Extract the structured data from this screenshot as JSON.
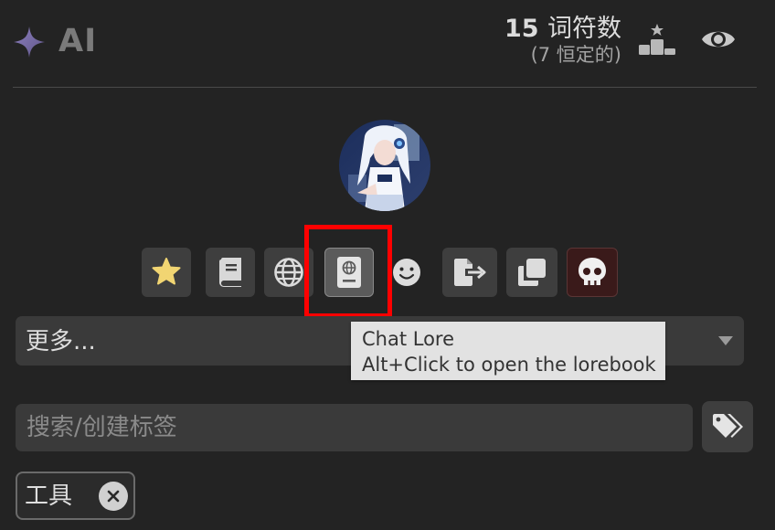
{
  "header": {
    "title": "AI",
    "title_icon": "sparkle-icon",
    "token_count": "15",
    "token_unit": "词符数",
    "token_permanent": "(7 恒定的)",
    "stats_icon": "podium-icon",
    "visibility_icon": "eye-icon"
  },
  "avatar": {
    "description_icon": "character-avatar"
  },
  "toolbar": {
    "buttons": [
      {
        "icon": "star-icon",
        "name": "favorite"
      },
      {
        "icon": "book-icon",
        "name": "character-lore"
      },
      {
        "icon": "globe-icon",
        "name": "world-info"
      },
      {
        "icon": "passport-icon",
        "name": "chat-lore",
        "active": true
      },
      {
        "icon": "smiley-icon",
        "name": "expressions"
      },
      {
        "icon": "export-icon",
        "name": "export"
      },
      {
        "icon": "duplicate-icon",
        "name": "duplicate"
      },
      {
        "icon": "skull-icon",
        "name": "delete"
      }
    ]
  },
  "more_select": {
    "value": "更多..."
  },
  "tooltip": {
    "line1": "Chat Lore",
    "line2": "Alt+Click to open the lorebook"
  },
  "tags": {
    "search_placeholder": "搜索/创建标签",
    "tag_button_icon": "tags-icon",
    "items": [
      {
        "label": "工具"
      }
    ],
    "remove_icon": "close-icon"
  },
  "colors": {
    "background": "#232323",
    "accent_sparkle": "#7c6fa0",
    "highlight": "#ff0000",
    "star": "#f0d070",
    "danger": "#3a1a1a"
  }
}
